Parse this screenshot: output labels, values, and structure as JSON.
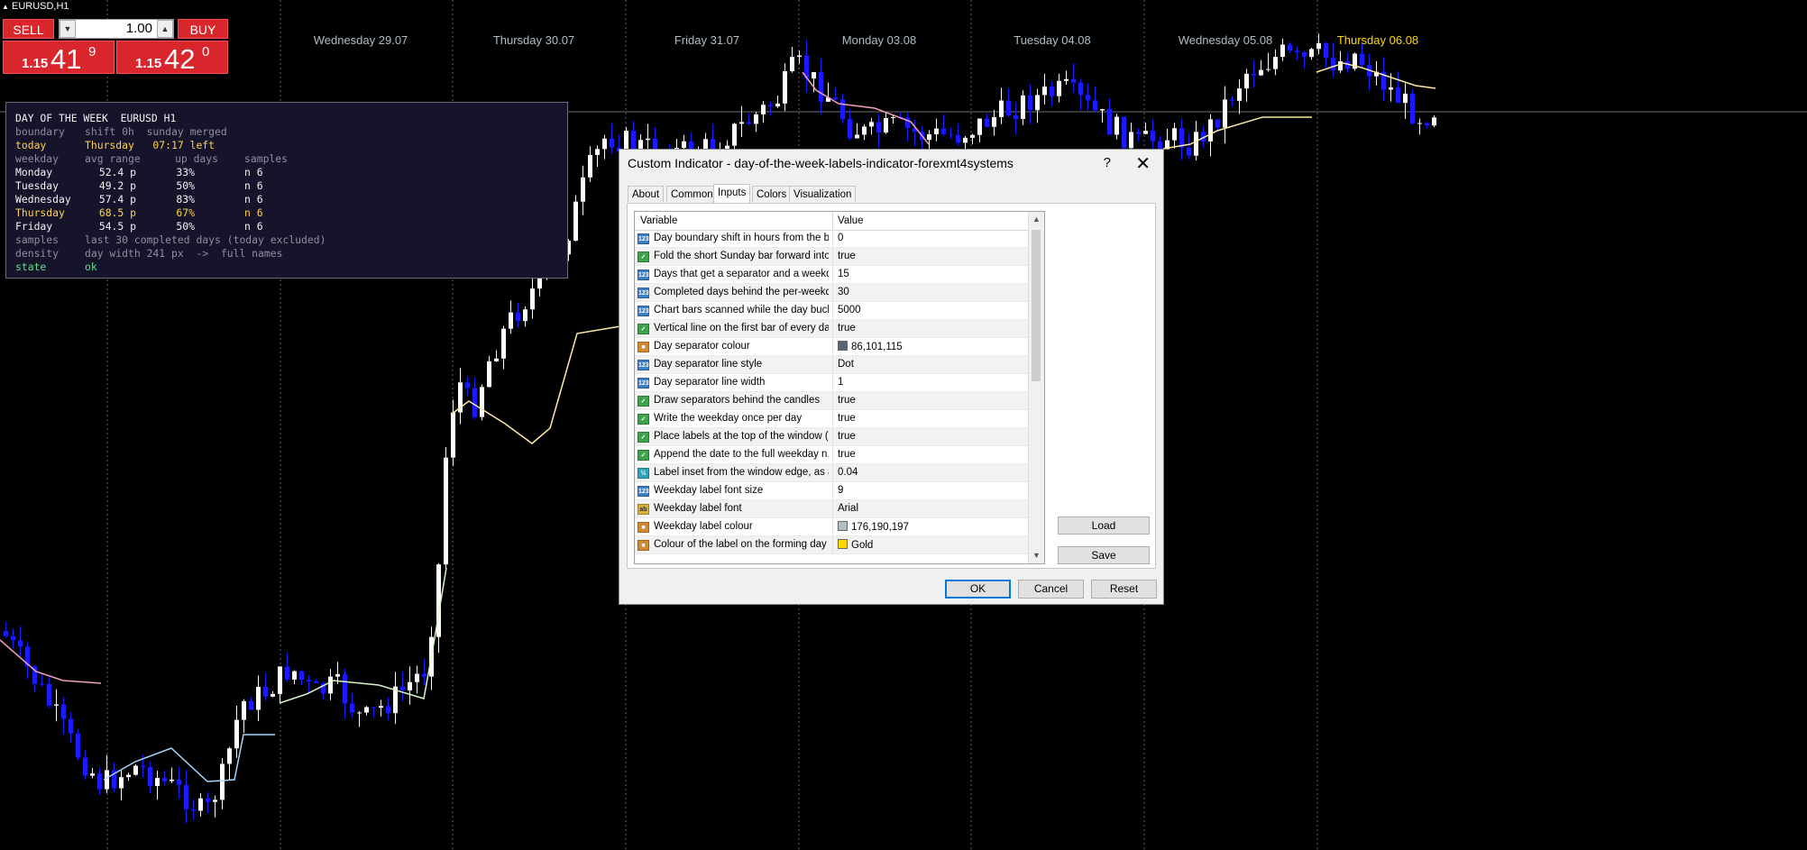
{
  "chart": {
    "symbol": "EURUSD,H1",
    "day_labels": [
      {
        "text": "Wednesday 29.07",
        "current": false
      },
      {
        "text": "Thursday 30.07",
        "current": false
      },
      {
        "text": "Friday 31.07",
        "current": false
      },
      {
        "text": "Monday 03.08",
        "current": false
      },
      {
        "text": "Tuesday 04.08",
        "current": false
      },
      {
        "text": "Wednesday 05.08",
        "current": false
      },
      {
        "text": "Thursday 06.08",
        "current": true
      }
    ],
    "colors": {
      "bull": "#ffffff",
      "bear": "#1a1aff",
      "separator": "#566573",
      "label": "#b0bec5",
      "forming": "#ffd700"
    }
  },
  "trade": {
    "sell_label": "SELL",
    "buy_label": "BUY",
    "lot": "1.00",
    "sell_price_prefix": "1.15",
    "sell_price_big": "41",
    "sell_price_sup": "9",
    "buy_price_prefix": "1.15",
    "buy_price_big": "42",
    "buy_price_sup": "0"
  },
  "info": {
    "title": "DAY OF THE WEEK  EURUSD H1",
    "boundary_label": "boundary",
    "boundary_value": "shift 0h  sunday merged",
    "today_label": "today",
    "today_value": "Thursday   07:17 left",
    "col_weekday": "weekday",
    "col_range": "avg range",
    "col_up": "up days",
    "col_samples": "samples",
    "rows": [
      {
        "day": "Monday",
        "range": "52.4 p",
        "up": "33%",
        "n": "n 6",
        "highlight": false
      },
      {
        "day": "Tuesday",
        "range": "49.2 p",
        "up": "50%",
        "n": "n 6",
        "highlight": false
      },
      {
        "day": "Wednesday",
        "range": "57.4 p",
        "up": "83%",
        "n": "n 6",
        "highlight": false
      },
      {
        "day": "Thursday",
        "range": "68.5 p",
        "up": "67%",
        "n": "n 6",
        "highlight": true
      },
      {
        "day": "Friday",
        "range": "54.5 p",
        "up": "50%",
        "n": "n 6",
        "highlight": false
      }
    ],
    "samples_label": "samples",
    "samples_value": "last 30 completed days (today excluded)",
    "density_label": "density",
    "density_value": "day width 241 px  ->  full names",
    "state_label": "state",
    "state_value": "ok"
  },
  "dialog": {
    "title": "Custom Indicator - day-of-the-week-labels-indicator-forexmt4systems",
    "help": "?",
    "close": "✕",
    "tabs": [
      "About",
      "Common",
      "Inputs",
      "Colors",
      "Visualization"
    ],
    "active_tab": "Inputs",
    "col_variable": "Variable",
    "col_value": "Value",
    "params": [
      {
        "icon": "i123",
        "name": "Day boundary shift in hours from the br...",
        "value": "0"
      },
      {
        "icon": "ibool",
        "name": "Fold the short Sunday bar forward into ...",
        "value": "true"
      },
      {
        "icon": "i123",
        "name": "Days that get a separator and a weekd...",
        "value": "15"
      },
      {
        "icon": "i123",
        "name": "Completed days behind the per-weekd...",
        "value": "30"
      },
      {
        "icon": "i123",
        "name": "Chart bars scanned while the day buck...",
        "value": "5000"
      },
      {
        "icon": "ibool",
        "name": "Vertical line on the first bar of every day",
        "value": "true"
      },
      {
        "icon": "iclr",
        "name": "Day separator colour",
        "value": "86,101,115",
        "swatch": "#566573"
      },
      {
        "icon": "i123",
        "name": "Day separator line style",
        "value": "Dot"
      },
      {
        "icon": "i123",
        "name": "Day separator line width",
        "value": "1"
      },
      {
        "icon": "ibool",
        "name": "Draw separators behind the candles",
        "value": "true"
      },
      {
        "icon": "ibool",
        "name": "Write the weekday once per day",
        "value": "true"
      },
      {
        "icon": "ibool",
        "name": "Place labels at the top of the window (f...",
        "value": "true"
      },
      {
        "icon": "ibool",
        "name": "Append the date to the full weekday n...",
        "value": "true"
      },
      {
        "icon": "ifrac",
        "name": "Label inset from the window edge, as a...",
        "value": "0.04"
      },
      {
        "icon": "i123",
        "name": "Weekday label font size",
        "value": "9"
      },
      {
        "icon": "istr",
        "name": "Weekday label font",
        "value": "Arial"
      },
      {
        "icon": "iclr",
        "name": "Weekday label colour",
        "value": "176,190,197",
        "swatch": "#b0bec5"
      },
      {
        "icon": "iclr",
        "name": "Colour of the label on the forming day",
        "value": "Gold",
        "swatch": "#ffd700"
      }
    ],
    "load_label": "Load",
    "save_label": "Save",
    "ok_label": "OK",
    "cancel_label": "Cancel",
    "reset_label": "Reset"
  }
}
